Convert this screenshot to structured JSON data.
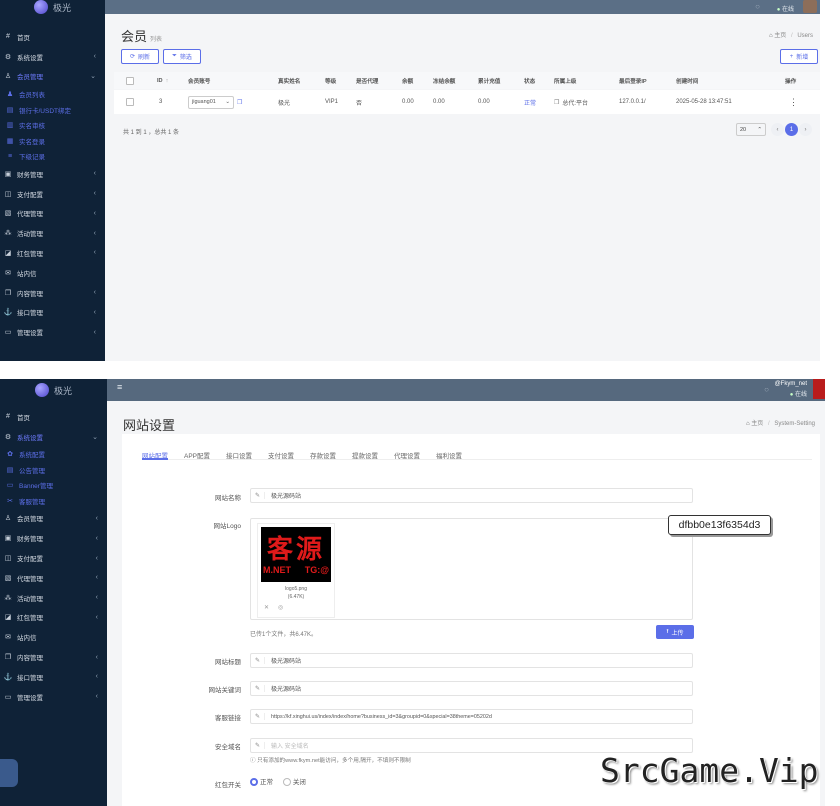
{
  "brand": "极光",
  "overlay": {
    "tooltip": "dfbb0e13f6354d3",
    "watermark": "SrcGame.Vip"
  },
  "panel1": {
    "status": "在线",
    "sidebar": [
      {
        "icon": "#",
        "label": "首页",
        "chev": false,
        "state": "normal"
      },
      {
        "icon": "⚙",
        "label": "系统设置",
        "chev": true,
        "state": "normal"
      },
      {
        "icon": "♙",
        "label": "会员管理",
        "chev": true,
        "state": "active",
        "chevDown": true
      },
      {
        "icon": "♟",
        "label": "会员列表",
        "chev": false,
        "state": "sub"
      },
      {
        "icon": "▤",
        "label": "银行卡/USDT绑定",
        "chev": false,
        "state": "sub"
      },
      {
        "icon": "▥",
        "label": "实名审核",
        "chev": false,
        "state": "sub"
      },
      {
        "icon": "▦",
        "label": "实名登录",
        "chev": false,
        "state": "sub"
      },
      {
        "icon": "≡",
        "label": "下级记录",
        "chev": false,
        "state": "sub"
      },
      {
        "icon": "▣",
        "label": "财务管理",
        "chev": true,
        "state": "normal"
      },
      {
        "icon": "◫",
        "label": "支付配置",
        "chev": true,
        "state": "normal"
      },
      {
        "icon": "▧",
        "label": "代理管理",
        "chev": true,
        "state": "normal"
      },
      {
        "icon": "⁂",
        "label": "活动管理",
        "chev": true,
        "state": "normal"
      },
      {
        "icon": "◪",
        "label": "红包管理",
        "chev": true,
        "state": "normal"
      },
      {
        "icon": "✉",
        "label": "站内信",
        "chev": false,
        "state": "normal"
      },
      {
        "icon": "❐",
        "label": "内容管理",
        "chev": true,
        "state": "normal"
      },
      {
        "icon": "⚓",
        "label": "接口管理",
        "chev": true,
        "state": "normal"
      },
      {
        "icon": "▭",
        "label": "管理设置",
        "chev": true,
        "state": "normal"
      }
    ],
    "title": "会员",
    "subtitle": "列表",
    "breadcrumb": {
      "home": "主页",
      "current": "Users"
    },
    "toolbar": {
      "refresh": "刷新",
      "filter": "筛选",
      "add": "新增"
    },
    "columns": [
      "ID",
      "会员账号",
      "真实姓名",
      "等级",
      "是否代理",
      "余额",
      "冻结余额",
      "累计充值",
      "状态",
      "所属上级",
      "最后登录IP",
      "创建时间",
      "操作"
    ],
    "row": {
      "id": "3",
      "account": "jiguang01",
      "realname": "极光",
      "level": "VIP1",
      "agent": "否",
      "balance": "0.00",
      "frozen": "0.00",
      "recharge": "0.00",
      "status": "正常",
      "parent": "总代:平台",
      "ip": "127.0.0.1/",
      "created": "2025-05-28 13:47:51",
      "action": "⋮"
    },
    "footer": "共 1 到 1 ，总共 1 条",
    "pagesize": "20",
    "page": "1"
  },
  "panel2": {
    "user": "@Fkym_net",
    "status": "在线",
    "sidebar": [
      {
        "icon": "#",
        "label": "首页",
        "chev": false,
        "state": "normal"
      },
      {
        "icon": "⚙",
        "label": "系统设置",
        "chev": true,
        "state": "active",
        "chevDown": true
      },
      {
        "icon": "✿",
        "label": "系统配置",
        "chev": false,
        "state": "sub"
      },
      {
        "icon": "▤",
        "label": "公告管理",
        "chev": false,
        "state": "sub"
      },
      {
        "icon": "▭",
        "label": "Banner管理",
        "chev": false,
        "state": "sub"
      },
      {
        "icon": "✂",
        "label": "客服管理",
        "chev": false,
        "state": "sub"
      },
      {
        "icon": "♙",
        "label": "会员管理",
        "chev": true,
        "state": "normal"
      },
      {
        "icon": "▣",
        "label": "财务管理",
        "chev": true,
        "state": "normal"
      },
      {
        "icon": "◫",
        "label": "支付配置",
        "chev": true,
        "state": "normal"
      },
      {
        "icon": "▧",
        "label": "代理管理",
        "chev": true,
        "state": "normal"
      },
      {
        "icon": "⁂",
        "label": "活动管理",
        "chev": true,
        "state": "normal"
      },
      {
        "icon": "◪",
        "label": "红包管理",
        "chev": true,
        "state": "normal"
      },
      {
        "icon": "✉",
        "label": "站内信",
        "chev": false,
        "state": "normal"
      },
      {
        "icon": "❐",
        "label": "内容管理",
        "chev": true,
        "state": "normal"
      },
      {
        "icon": "⚓",
        "label": "接口管理",
        "chev": true,
        "state": "normal"
      },
      {
        "icon": "▭",
        "label": "管理设置",
        "chev": true,
        "state": "normal"
      }
    ],
    "title": "网站设置",
    "breadcrumb": {
      "home": "主页",
      "current": "System-Setting"
    },
    "tabs": [
      "网站配置",
      "APP配置",
      "接口设置",
      "支付设置",
      "存款设置",
      "提款设置",
      "代理设置",
      "福利设置"
    ],
    "fields": {
      "name": {
        "label": "网站名称",
        "value": "极光源码站"
      },
      "logo": {
        "label": "网站Logo",
        "file": "logo5.png",
        "size": "(6.47K)",
        "info": "已传1个文件，共6.47K。",
        "upload": "上传",
        "logo_cn": "客源",
        "logo_en_left": "M.NET",
        "logo_en_right": "TG:@"
      },
      "title": {
        "label": "网站标题",
        "value": "极光源码站"
      },
      "keywords": {
        "label": "网站关键词",
        "value": "极光源码站"
      },
      "service": {
        "label": "客服链接",
        "value": "https://kf.xinghui.us/index/index/home?business_id=3&groupid=0&special=38theme=05202d"
      },
      "domain": {
        "label": "安全域名",
        "placeholder": "输入 安全域名",
        "hint": "只有添加的www.fkym.net能访问，多个用,隔开，不填则不限制"
      },
      "redpack": {
        "label": "红包开关",
        "on": "正常",
        "off": "关闭"
      }
    }
  }
}
